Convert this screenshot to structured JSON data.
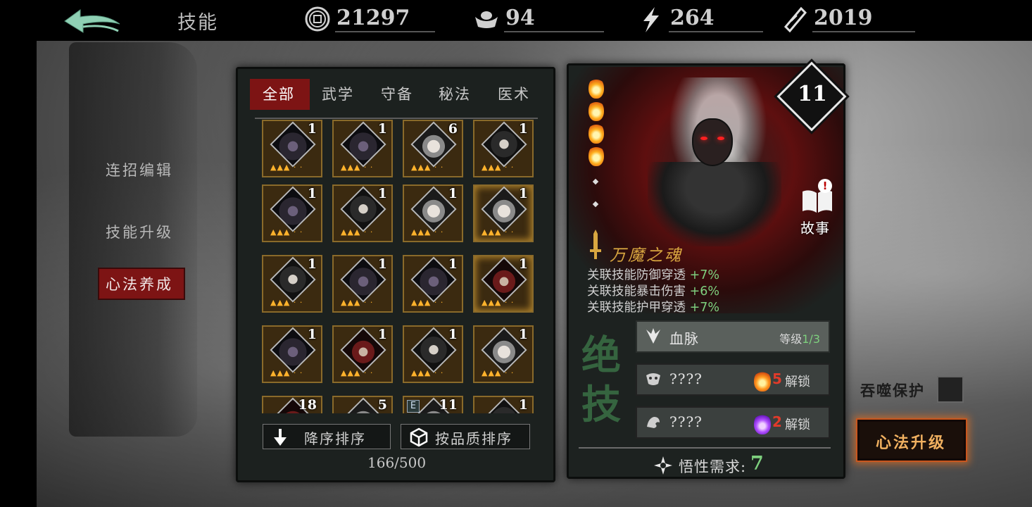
{
  "topbar": {
    "title": "技能",
    "resources": [
      {
        "icon": "copper-coin-icon",
        "value": "21297"
      },
      {
        "icon": "silver-ingot-icon",
        "value": "94"
      },
      {
        "icon": "lightning-icon",
        "value": "264"
      },
      {
        "icon": "ticket-icon",
        "value": "2019"
      }
    ]
  },
  "sidebar": {
    "items": [
      {
        "label": "连招编辑",
        "active": false
      },
      {
        "label": "技能升级",
        "active": false
      },
      {
        "label": "心法养成",
        "active": true
      }
    ]
  },
  "tabs": [
    {
      "label": "全部",
      "active": true
    },
    {
      "label": "武学",
      "active": false
    },
    {
      "label": "守备",
      "active": false
    },
    {
      "label": "秘法",
      "active": false
    },
    {
      "label": "医术",
      "active": false
    }
  ],
  "grid": {
    "cells": [
      {
        "count": "1",
        "style": "dark"
      },
      {
        "count": "1",
        "style": "dark"
      },
      {
        "count": "6",
        "style": "pale"
      },
      {
        "count": "1",
        "style": "normal"
      },
      {
        "count": "1",
        "style": "dark"
      },
      {
        "count": "1",
        "style": "normal"
      },
      {
        "count": "1",
        "style": "pale"
      },
      {
        "count": "1",
        "style": "pale"
      },
      {
        "count": "1",
        "style": "normal"
      },
      {
        "count": "1",
        "style": "dark"
      },
      {
        "count": "1",
        "style": "dark"
      },
      {
        "count": "1",
        "style": "red"
      },
      {
        "count": "1",
        "style": "dark"
      },
      {
        "count": "1",
        "style": "red"
      },
      {
        "count": "1",
        "style": "normal"
      },
      {
        "count": "1",
        "style": "pale"
      },
      {
        "count": "18",
        "style": "red"
      },
      {
        "count": "5",
        "style": "pale"
      },
      {
        "count": "11",
        "style": "pale",
        "tag": "E"
      },
      {
        "count": "1",
        "style": "normal"
      }
    ]
  },
  "sort": {
    "desc_label": "降序排序",
    "quality_label": "按品质排序"
  },
  "count": "166/500",
  "detail": {
    "level": "11",
    "story_label": "故事",
    "story_alert": "!",
    "skill_name": "万魔之魂",
    "stats": [
      {
        "text": "关联技能防御穿透",
        "bonus": "+7%"
      },
      {
        "text": "关联技能暴击伤害",
        "bonus": "+6%"
      },
      {
        "text": "关联技能护甲穿透",
        "bonus": "+7%"
      }
    ],
    "jueji": "绝技",
    "bloodline": {
      "name": "血脉",
      "level_label": "等级",
      "level": "1/3"
    },
    "locked_slots": [
      {
        "name": "????",
        "count": "5",
        "unlock": "解锁",
        "flame": "orange"
      },
      {
        "name": "????",
        "count": "2",
        "unlock": "解锁",
        "flame": "purple"
      }
    ],
    "insight_label": "悟性需求:",
    "insight_value": "7"
  },
  "right": {
    "devour_label": "吞噬保护",
    "upgrade_label": "心法升级"
  },
  "colors": {
    "active_red": "#7d1414",
    "bonus_green": "#7ed07e",
    "gold": "#d8a640",
    "upgrade_glow": "#c9561e"
  }
}
